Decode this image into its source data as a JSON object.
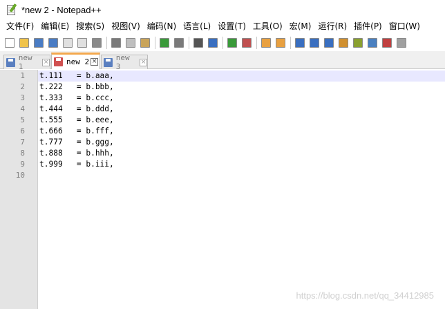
{
  "window": {
    "title": "*new 2 - Notepad++"
  },
  "menu": [
    "文件(F)",
    "编辑(E)",
    "搜索(S)",
    "视图(V)",
    "编码(N)",
    "语言(L)",
    "设置(T)",
    "工具(O)",
    "宏(M)",
    "运行(R)",
    "插件(P)",
    "窗口(W)"
  ],
  "toolbar": {
    "buttons": [
      {
        "name": "new-file-icon",
        "color": "#ffffff"
      },
      {
        "name": "open-file-icon",
        "color": "#f0c34a"
      },
      {
        "name": "save-icon",
        "color": "#4a7cc4"
      },
      {
        "name": "save-all-icon",
        "color": "#4a7cc4"
      },
      {
        "name": "close-icon",
        "color": "#e0e0e0"
      },
      {
        "name": "close-all-icon",
        "color": "#e0e0e0"
      },
      {
        "name": "print-icon",
        "color": "#8a8a8a"
      },
      {
        "sep": true
      },
      {
        "name": "cut-icon",
        "color": "#7a7a7a"
      },
      {
        "name": "copy-icon",
        "color": "#bfbfbf"
      },
      {
        "name": "paste-icon",
        "color": "#c9a45a"
      },
      {
        "sep": true
      },
      {
        "name": "undo-icon",
        "color": "#3b9a3b"
      },
      {
        "name": "redo-icon",
        "color": "#7a7a7a"
      },
      {
        "sep": true
      },
      {
        "name": "find-icon",
        "color": "#555555"
      },
      {
        "name": "replace-icon",
        "color": "#3a6fc0"
      },
      {
        "sep": true
      },
      {
        "name": "zoom-in-icon",
        "color": "#3a9a3a"
      },
      {
        "name": "zoom-out-icon",
        "color": "#c05050"
      },
      {
        "sep": true
      },
      {
        "name": "sync-vertical-icon",
        "color": "#e8a040"
      },
      {
        "name": "sync-horizontal-icon",
        "color": "#e8a040"
      },
      {
        "sep": true
      },
      {
        "name": "word-wrap-icon",
        "color": "#3a6fc0"
      },
      {
        "name": "show-all-chars-icon",
        "color": "#3a6fc0"
      },
      {
        "name": "indent-guide-icon",
        "color": "#3a6fc0"
      },
      {
        "name": "user-defined-lang-icon",
        "color": "#d09030"
      },
      {
        "name": "doc-map-icon",
        "color": "#8aa030"
      },
      {
        "name": "function-list-icon",
        "color": "#4a80c0"
      },
      {
        "name": "folder-workspace-icon",
        "color": "#c04040"
      },
      {
        "name": "monitoring-icon",
        "color": "#a0a0a0"
      }
    ]
  },
  "tabs": [
    {
      "label": "new 1",
      "active": false,
      "icon_color": "#5a7fc0"
    },
    {
      "label": "new 2",
      "active": true,
      "icon_color": "#d05050"
    },
    {
      "label": "new 3",
      "active": false,
      "icon_color": "#5a7fc0"
    }
  ],
  "tab_close_glyph": "×",
  "editor": {
    "lines": [
      {
        "num": "1",
        "text": "t.111   = b.aaa,"
      },
      {
        "num": "2",
        "text": "t.222   = b.bbb,"
      },
      {
        "num": "3",
        "text": "t.333   = b.ccc,"
      },
      {
        "num": "4",
        "text": "t.444   = b.ddd,"
      },
      {
        "num": "5",
        "text": "t.555   = b.eee,"
      },
      {
        "num": "6",
        "text": "t.666   = b.fff,"
      },
      {
        "num": "7",
        "text": "t.777   = b.ggg,"
      },
      {
        "num": "8",
        "text": "t.888   = b.hhh,"
      },
      {
        "num": "9",
        "text": "t.999   = b.iii,"
      },
      {
        "num": "10",
        "text": ""
      }
    ]
  },
  "watermark": "https://blog.csdn.net/qq_34412985"
}
